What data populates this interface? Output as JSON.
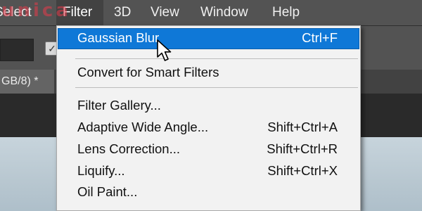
{
  "watermark": {
    "text": "unica"
  },
  "menubar": {
    "items": [
      {
        "label": "Select"
      },
      {
        "label": "Filter"
      },
      {
        "label": "3D"
      },
      {
        "label": "View"
      },
      {
        "label": "Window"
      },
      {
        "label": "Help"
      }
    ],
    "active": "Filter"
  },
  "optionsbar": {
    "check_glyph": "✓"
  },
  "document_tab": {
    "label": "GB/8) *"
  },
  "filter_menu": {
    "items": [
      {
        "label": "Gaussian Blur",
        "shortcut": "Ctrl+F",
        "highlighted": true
      },
      {
        "label": "Convert for Smart Filters",
        "shortcut": ""
      },
      {
        "label": "Filter Gallery...",
        "shortcut": ""
      },
      {
        "label": "Adaptive Wide Angle...",
        "shortcut": "Shift+Ctrl+A"
      },
      {
        "label": "Lens Correction...",
        "shortcut": "Shift+Ctrl+R"
      },
      {
        "label": "Liquify...",
        "shortcut": "Shift+Ctrl+X"
      },
      {
        "label": "Oil Paint...",
        "shortcut": ""
      }
    ]
  },
  "colors": {
    "highlight": "#0f78d7",
    "menubar": "#535353",
    "watermark": "#e63a4a"
  },
  "cursor_icon": "arrow-pointer-icon"
}
